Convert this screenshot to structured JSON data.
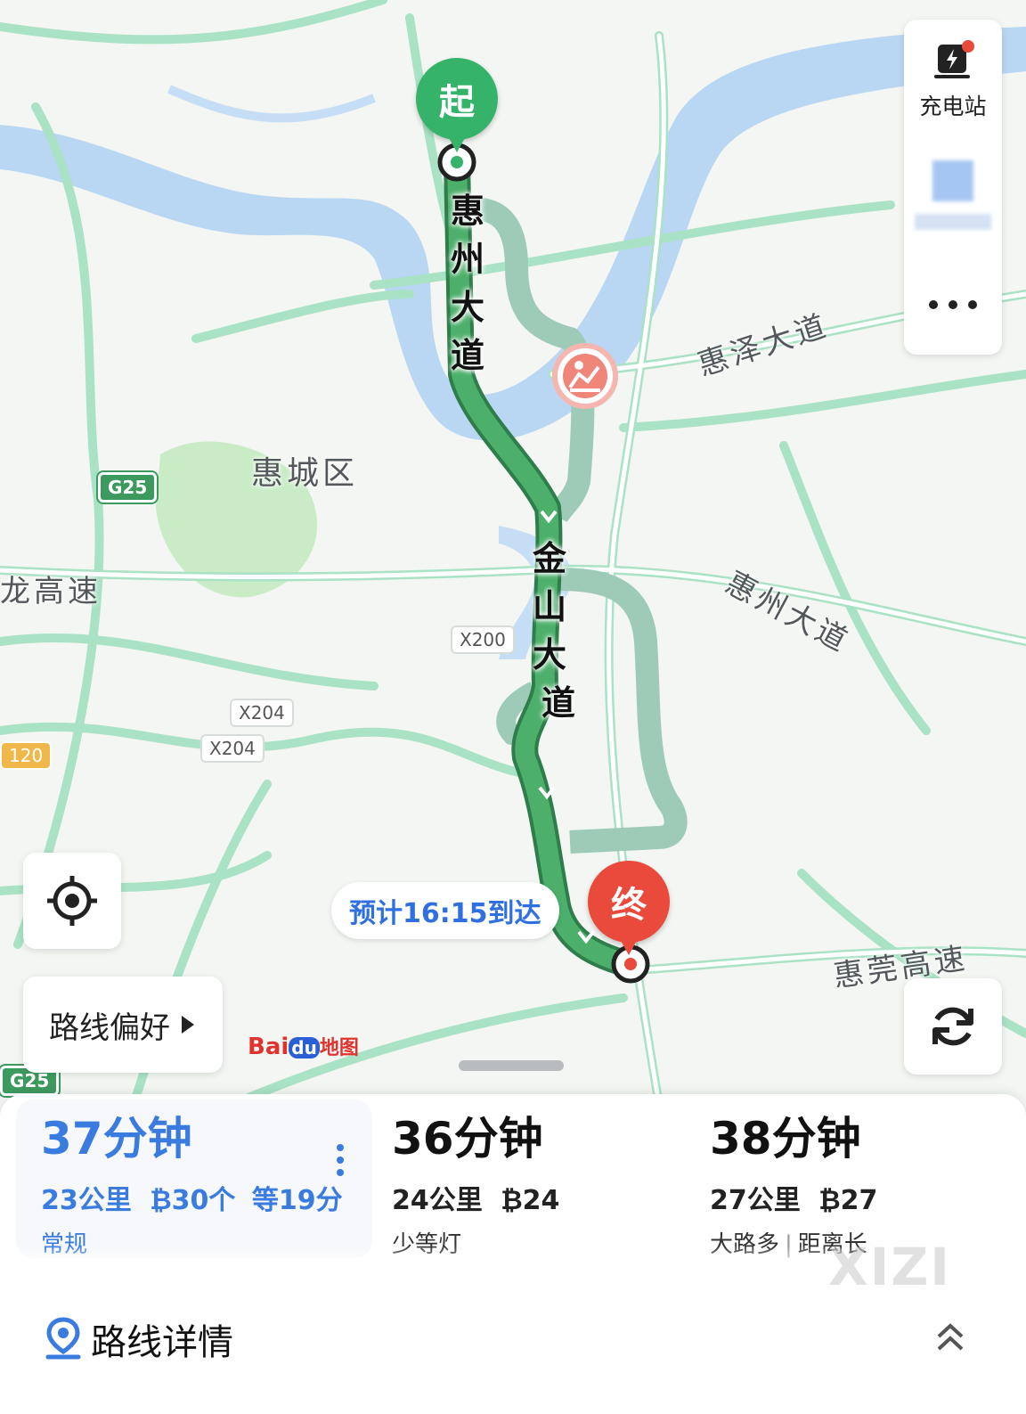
{
  "map": {
    "district_label": "惠城区",
    "roads": {
      "huizhou_ave_vertical": [
        "惠",
        "州",
        "大",
        "道"
      ],
      "jinshan_ave_vertical": [
        "金",
        "山",
        "大",
        "道"
      ],
      "huize_ave": "惠泽大道",
      "huizhou_ave_diag": "惠州大道",
      "huiguan_expwy": "惠莞高速",
      "left_expwy": "龙高速"
    },
    "shields": {
      "g25_top": "G25",
      "g25_bottom": "G25",
      "x200": "X200",
      "x204_a": "X204",
      "x204_b": "X204",
      "s120": "120"
    },
    "start_marker": "起",
    "end_marker": "终",
    "eta_bubble": "预计16:15到达",
    "watermark_brand": "Bai",
    "watermark_brand2": "du",
    "watermark_brand3": "地图",
    "colors": {
      "route_main": "#4caf6a",
      "route_alt": "#9dcbb8",
      "water": "#b9d6f3",
      "park": "#c9ecc6",
      "road": "#ffffff",
      "road_edge": "#a9e2c5"
    }
  },
  "side_controls": {
    "charging_label": "充电站",
    "charging_icon": "charging-station-icon",
    "more_icon": "more-dots-icon",
    "locate_icon": "locate-crosshair-icon",
    "refresh_icon": "refresh-icon",
    "route_pref_label": "路线偏好",
    "route_pref_icon": "triangle-right-icon"
  },
  "routes": [
    {
      "time": "37分钟",
      "distance": "23公里",
      "lights": "30个",
      "wait": "等19分",
      "tag": "常规",
      "selected": true
    },
    {
      "time": "36分钟",
      "distance": "24公里",
      "lights": "24",
      "wait": "",
      "tag": "少等灯",
      "selected": false
    },
    {
      "time": "38分钟",
      "distance": "27公里",
      "lights": "27",
      "wait": "",
      "tag": "大路多",
      "tag2": "距离长",
      "selected": false
    }
  ],
  "details": {
    "label": "路线详情",
    "icon": "location-pin-icon",
    "expand_icon": "double-chevron-up-icon"
  },
  "watermark": "XIZI"
}
